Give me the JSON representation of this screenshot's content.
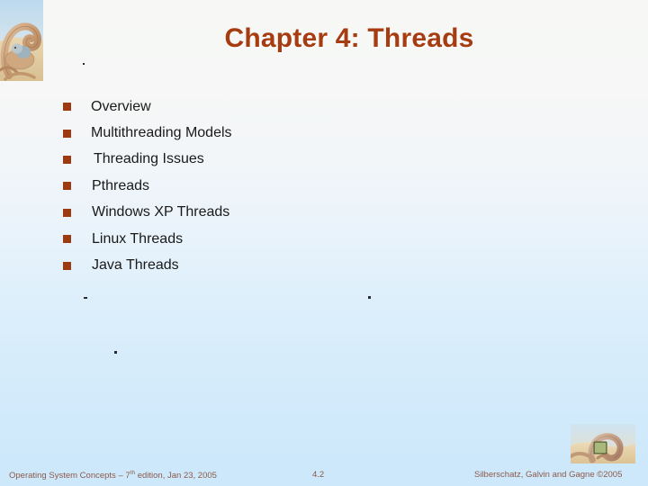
{
  "slide": {
    "title": "Chapter 4: Threads",
    "title_color": "#a63c10",
    "background_top_color": "#f7f8f6",
    "background_bottom_color": "#cde8fb",
    "bullet_marker_color": "#9c3b12",
    "bullets": [
      {
        "label": "Overview"
      },
      {
        "label": "Multithreading Models"
      },
      {
        "label": "Threading Issues"
      },
      {
        "label": "Pthreads"
      },
      {
        "label": "Windows XP Threads"
      },
      {
        "label": "Linux Threads"
      },
      {
        "label": "Java Threads"
      }
    ]
  },
  "footer": {
    "source_prefix": "Operating System Concepts – 7",
    "source_superscript": "th",
    "source_suffix": " edition, Jan 23, 2005",
    "page_number": "4.2",
    "copyright": "Silberschatz, Galvin and Gagne ©2005",
    "text_color": "#8c5a4a"
  },
  "artwork": {
    "corner_image": "dinosaur-illustration",
    "footer_image": "dinosaur-with-book-illustration"
  }
}
